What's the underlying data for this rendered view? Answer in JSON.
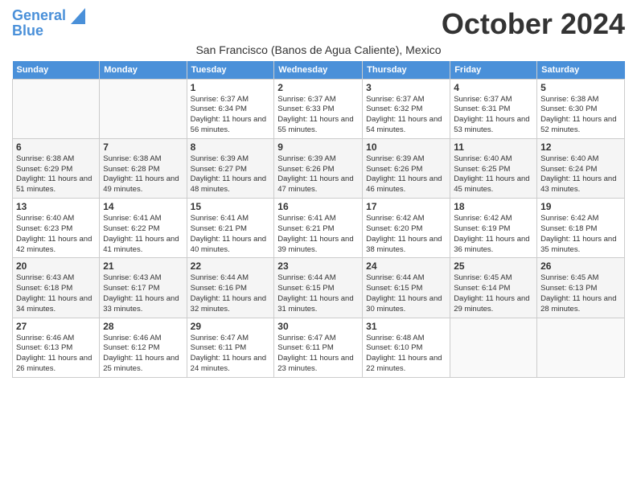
{
  "logo": {
    "line1": "General",
    "line2": "Blue"
  },
  "title": "October 2024",
  "location": "San Francisco (Banos de Agua Caliente), Mexico",
  "days_of_week": [
    "Sunday",
    "Monday",
    "Tuesday",
    "Wednesday",
    "Thursday",
    "Friday",
    "Saturday"
  ],
  "weeks": [
    [
      {
        "day": "",
        "sunrise": "",
        "sunset": "",
        "daylight": ""
      },
      {
        "day": "",
        "sunrise": "",
        "sunset": "",
        "daylight": ""
      },
      {
        "day": "1",
        "sunrise": "Sunrise: 6:37 AM",
        "sunset": "Sunset: 6:34 PM",
        "daylight": "Daylight: 11 hours and 56 minutes."
      },
      {
        "day": "2",
        "sunrise": "Sunrise: 6:37 AM",
        "sunset": "Sunset: 6:33 PM",
        "daylight": "Daylight: 11 hours and 55 minutes."
      },
      {
        "day": "3",
        "sunrise": "Sunrise: 6:37 AM",
        "sunset": "Sunset: 6:32 PM",
        "daylight": "Daylight: 11 hours and 54 minutes."
      },
      {
        "day": "4",
        "sunrise": "Sunrise: 6:37 AM",
        "sunset": "Sunset: 6:31 PM",
        "daylight": "Daylight: 11 hours and 53 minutes."
      },
      {
        "day": "5",
        "sunrise": "Sunrise: 6:38 AM",
        "sunset": "Sunset: 6:30 PM",
        "daylight": "Daylight: 11 hours and 52 minutes."
      }
    ],
    [
      {
        "day": "6",
        "sunrise": "Sunrise: 6:38 AM",
        "sunset": "Sunset: 6:29 PM",
        "daylight": "Daylight: 11 hours and 51 minutes."
      },
      {
        "day": "7",
        "sunrise": "Sunrise: 6:38 AM",
        "sunset": "Sunset: 6:28 PM",
        "daylight": "Daylight: 11 hours and 49 minutes."
      },
      {
        "day": "8",
        "sunrise": "Sunrise: 6:39 AM",
        "sunset": "Sunset: 6:27 PM",
        "daylight": "Daylight: 11 hours and 48 minutes."
      },
      {
        "day": "9",
        "sunrise": "Sunrise: 6:39 AM",
        "sunset": "Sunset: 6:26 PM",
        "daylight": "Daylight: 11 hours and 47 minutes."
      },
      {
        "day": "10",
        "sunrise": "Sunrise: 6:39 AM",
        "sunset": "Sunset: 6:26 PM",
        "daylight": "Daylight: 11 hours and 46 minutes."
      },
      {
        "day": "11",
        "sunrise": "Sunrise: 6:40 AM",
        "sunset": "Sunset: 6:25 PM",
        "daylight": "Daylight: 11 hours and 45 minutes."
      },
      {
        "day": "12",
        "sunrise": "Sunrise: 6:40 AM",
        "sunset": "Sunset: 6:24 PM",
        "daylight": "Daylight: 11 hours and 43 minutes."
      }
    ],
    [
      {
        "day": "13",
        "sunrise": "Sunrise: 6:40 AM",
        "sunset": "Sunset: 6:23 PM",
        "daylight": "Daylight: 11 hours and 42 minutes."
      },
      {
        "day": "14",
        "sunrise": "Sunrise: 6:41 AM",
        "sunset": "Sunset: 6:22 PM",
        "daylight": "Daylight: 11 hours and 41 minutes."
      },
      {
        "day": "15",
        "sunrise": "Sunrise: 6:41 AM",
        "sunset": "Sunset: 6:21 PM",
        "daylight": "Daylight: 11 hours and 40 minutes."
      },
      {
        "day": "16",
        "sunrise": "Sunrise: 6:41 AM",
        "sunset": "Sunset: 6:21 PM",
        "daylight": "Daylight: 11 hours and 39 minutes."
      },
      {
        "day": "17",
        "sunrise": "Sunrise: 6:42 AM",
        "sunset": "Sunset: 6:20 PM",
        "daylight": "Daylight: 11 hours and 38 minutes."
      },
      {
        "day": "18",
        "sunrise": "Sunrise: 6:42 AM",
        "sunset": "Sunset: 6:19 PM",
        "daylight": "Daylight: 11 hours and 36 minutes."
      },
      {
        "day": "19",
        "sunrise": "Sunrise: 6:42 AM",
        "sunset": "Sunset: 6:18 PM",
        "daylight": "Daylight: 11 hours and 35 minutes."
      }
    ],
    [
      {
        "day": "20",
        "sunrise": "Sunrise: 6:43 AM",
        "sunset": "Sunset: 6:18 PM",
        "daylight": "Daylight: 11 hours and 34 minutes."
      },
      {
        "day": "21",
        "sunrise": "Sunrise: 6:43 AM",
        "sunset": "Sunset: 6:17 PM",
        "daylight": "Daylight: 11 hours and 33 minutes."
      },
      {
        "day": "22",
        "sunrise": "Sunrise: 6:44 AM",
        "sunset": "Sunset: 6:16 PM",
        "daylight": "Daylight: 11 hours and 32 minutes."
      },
      {
        "day": "23",
        "sunrise": "Sunrise: 6:44 AM",
        "sunset": "Sunset: 6:15 PM",
        "daylight": "Daylight: 11 hours and 31 minutes."
      },
      {
        "day": "24",
        "sunrise": "Sunrise: 6:44 AM",
        "sunset": "Sunset: 6:15 PM",
        "daylight": "Daylight: 11 hours and 30 minutes."
      },
      {
        "day": "25",
        "sunrise": "Sunrise: 6:45 AM",
        "sunset": "Sunset: 6:14 PM",
        "daylight": "Daylight: 11 hours and 29 minutes."
      },
      {
        "day": "26",
        "sunrise": "Sunrise: 6:45 AM",
        "sunset": "Sunset: 6:13 PM",
        "daylight": "Daylight: 11 hours and 28 minutes."
      }
    ],
    [
      {
        "day": "27",
        "sunrise": "Sunrise: 6:46 AM",
        "sunset": "Sunset: 6:13 PM",
        "daylight": "Daylight: 11 hours and 26 minutes."
      },
      {
        "day": "28",
        "sunrise": "Sunrise: 6:46 AM",
        "sunset": "Sunset: 6:12 PM",
        "daylight": "Daylight: 11 hours and 25 minutes."
      },
      {
        "day": "29",
        "sunrise": "Sunrise: 6:47 AM",
        "sunset": "Sunset: 6:11 PM",
        "daylight": "Daylight: 11 hours and 24 minutes."
      },
      {
        "day": "30",
        "sunrise": "Sunrise: 6:47 AM",
        "sunset": "Sunset: 6:11 PM",
        "daylight": "Daylight: 11 hours and 23 minutes."
      },
      {
        "day": "31",
        "sunrise": "Sunrise: 6:48 AM",
        "sunset": "Sunset: 6:10 PM",
        "daylight": "Daylight: 11 hours and 22 minutes."
      },
      {
        "day": "",
        "sunrise": "",
        "sunset": "",
        "daylight": ""
      },
      {
        "day": "",
        "sunrise": "",
        "sunset": "",
        "daylight": ""
      }
    ]
  ]
}
